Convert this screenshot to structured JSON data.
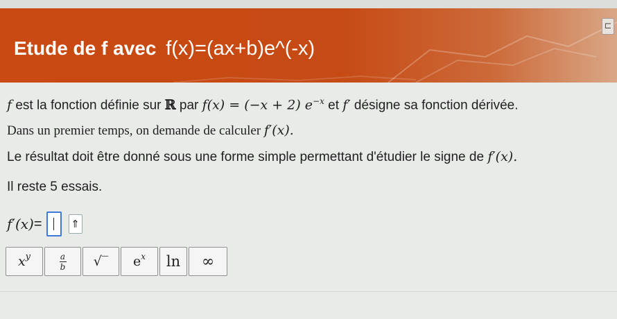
{
  "header": {
    "title_prefix": "Etude de f avec",
    "title_formula": "f(x)=(ax+b)e^(-x)",
    "corner_icon": "bracket-icon"
  },
  "statement": {
    "line1_prefix": "f",
    "line1_text": " est la fonction définie sur ",
    "line1_set": "ℝ",
    "line1_par": " par ",
    "line1_formula_a": "f(x) = (−x + 2) e",
    "line1_formula_exp": "−x",
    "line1_et": " et ",
    "line1_fprime": "f′",
    "line1_end": " désigne sa fonction dérivée.",
    "line2_text": "Dans un premier temps, on demande de calculer ",
    "line2_formula": "f′(x).",
    "line3_text": "Le résultat doit être donné sous une forme simple permettant d'étudier le signe de ",
    "line3_formula": "f′(x).",
    "line4_text": "Il reste 5 essais."
  },
  "answer": {
    "label_math": "f′(x)",
    "label_eq": " =",
    "submit_glyph": "⇑"
  },
  "toolbar": {
    "power_base": "x",
    "power_exp": "y",
    "frac_num": "a",
    "frac_den": "b",
    "sqrt": "√‾",
    "exp_base": "e",
    "exp_exp": "x",
    "ln": "ln",
    "infinity": "∞"
  }
}
